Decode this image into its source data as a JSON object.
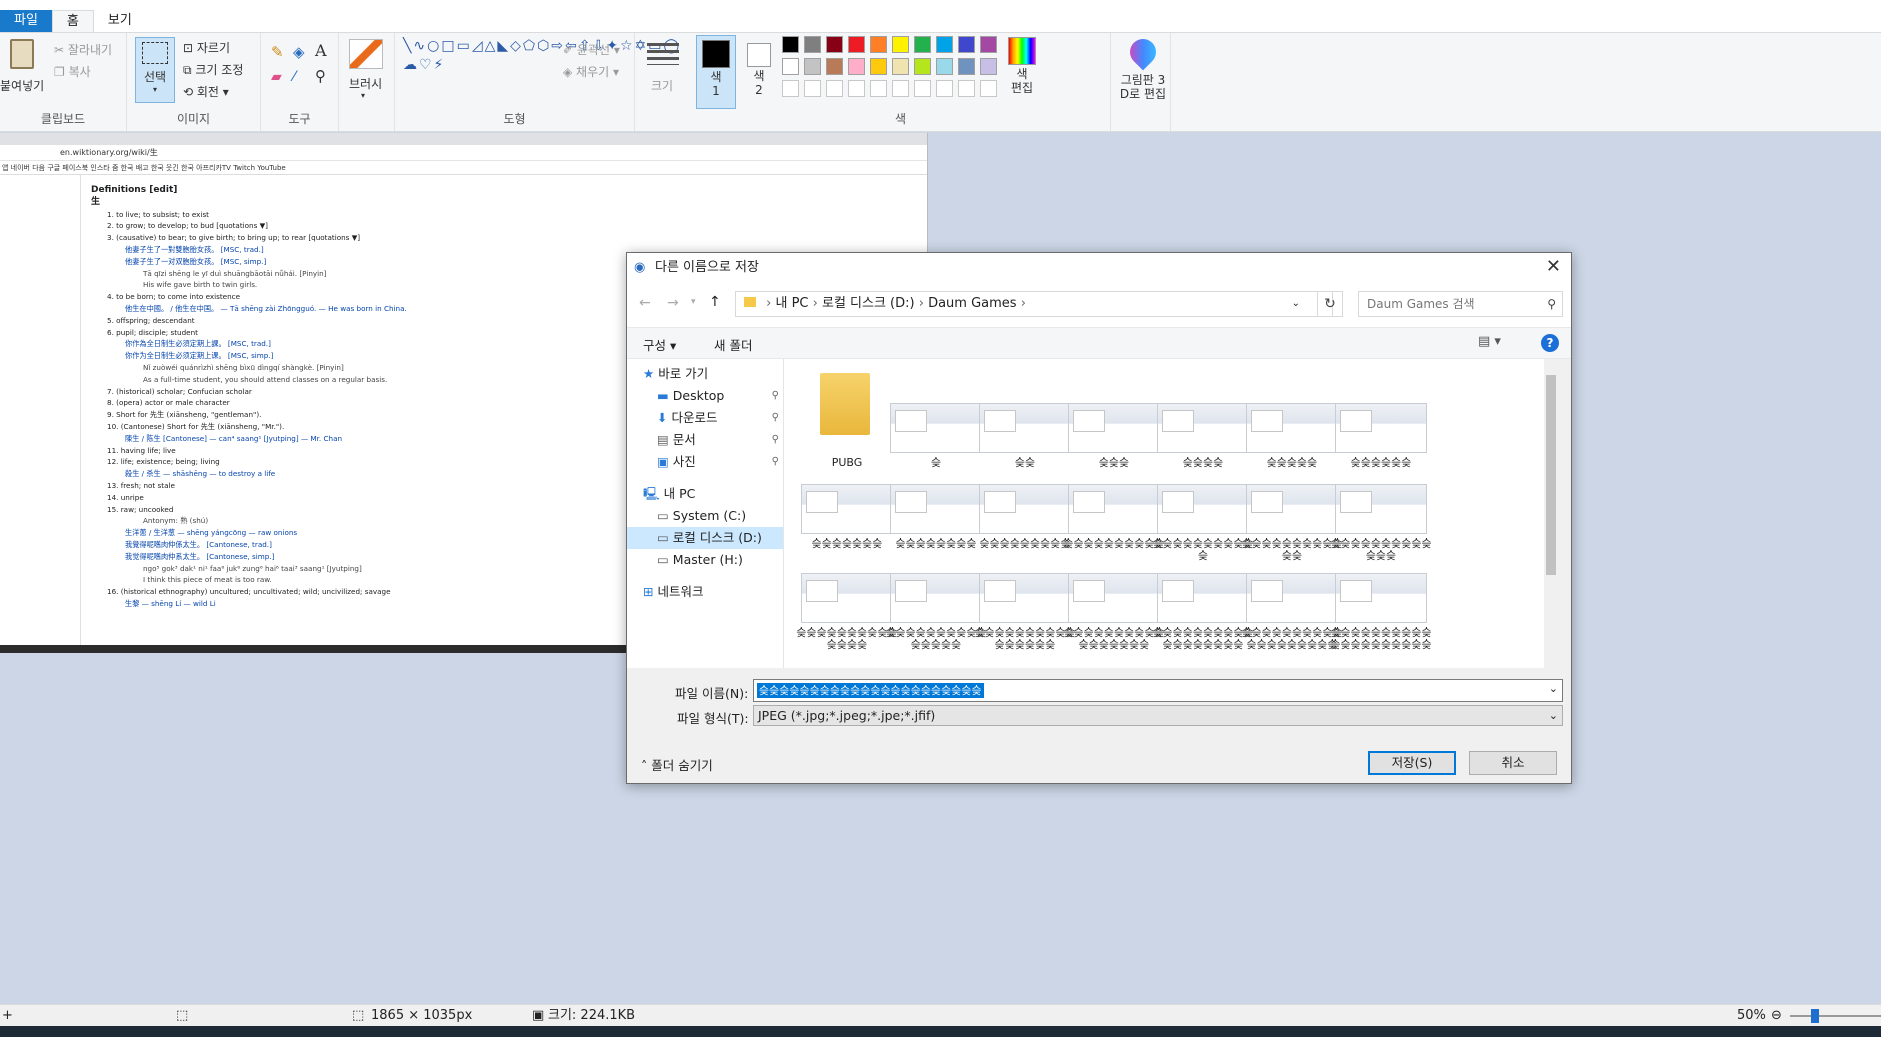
{
  "ribbon": {
    "tabs": [
      "파일",
      "홈",
      "보기"
    ],
    "clipboard": {
      "paste": "붙여넣기",
      "cut": "잘라내기",
      "copy": "복사",
      "label": "클립보드"
    },
    "image": {
      "select": "선택",
      "crop": "자르기",
      "resize": "크기 조정",
      "rotate": "회전",
      "label": "이미지"
    },
    "tools": {
      "label": "도구"
    },
    "brushes": {
      "label": "브러시"
    },
    "shapes": {
      "outline": "윤곽선",
      "fill": "채우기",
      "label": "도형"
    },
    "size": {
      "label": "크기"
    },
    "colors": {
      "color1": "색\n1",
      "color2": "색\n2",
      "edit": "색\n편집",
      "label": "색",
      "palette": [
        "#000000",
        "#7f7f7f",
        "#880015",
        "#ed1c24",
        "#ff7f27",
        "#fff200",
        "#22b14c",
        "#00a2e8",
        "#3f48cc",
        "#a349a4",
        "#ffffff",
        "#c3c3c3",
        "#b97a57",
        "#ffaec9",
        "#ffc90e",
        "#efe4b0",
        "#b5e61d",
        "#99d9ea",
        "#7092be",
        "#c8bfe7"
      ]
    },
    "paint3d": "그림판 3\nD로 편집"
  },
  "canvas_page": {
    "url": "en.wiktionary.org/wiki/生",
    "bookmarks": "앱   네이버   다음   구글   페이스북   인스타   줌 한국   배고 한국   웃긴 한국   아프리카TV   Twitch   YouTube",
    "heading": "Definitions  [edit]",
    "char": "生",
    "items": [
      "1. to live; to subsist; to exist",
      "2. to grow; to develop; to bud  [quotations ▼]",
      "3. (causative) to bear; to give birth; to bring up; to rear  [quotations ▼]",
      "他妻子生了一對雙胞胎女孩。 [MSC, trad.]",
      "他妻子生了一对双胞胎女孩。 [MSC, simp.]",
      "Tā qīzi shēng le yī duì shuāngbāotāi nǚhái. [Pinyin]",
      "His wife gave birth to twin girls.",
      "4. to be born; to come into existence",
      "他生在中國。 / 他生在中国。 — Tā shēng zài Zhōngguó. — He was born in China.",
      "5. offspring; descendant",
      "6. pupil; disciple; student",
      "你作為全日制生必須定期上課。 [MSC, trad.]",
      "你作为全日制生必须定期上课。 [MSC, simp.]",
      "Nǐ zuòwéi quánrìzhì shēng bìxū dìngqí shàngkè. [Pinyin]",
      "As a full-time student, you should attend classes on a regular basis.",
      "7. (historical) scholar; Confucian scholar",
      "8. (opera) actor or male character",
      "9. Short for 先生 (xiānsheng, \"gentleman\").",
      "10. (Cantonese) Short for 先生 (xiānsheng, \"Mr.\").",
      "陳生 / 陈生 [Cantonese] — can⁴ saang¹ [Jyutping] — Mr. Chan",
      "11. having life; live",
      "12. life; existence; being; living",
      "殺生 / 杀生 — shāshēng — to destroy a life",
      "13. fresh; not stale",
      "14. unripe",
      "15. raw; uncooked",
      "Antonym: 熟 (shú)",
      "生洋蔥 / 生洋葱 — shēng yángcōng — raw onions",
      "我覺得呢嚿肉仲係太生。 [Cantonese, trad.]",
      "我觉得呢嚿肉仲系太生。 [Cantonese, simp.]",
      "ngo⁵ gok³ dak¹ ni¹ faa⁶ juk⁶ zung⁶ hai⁶ taai³ saang¹ [Jyutping]",
      "I think this piece of meat is too raw.",
      "16. (historical ethnography) uncultured; uncultivated; wild; uncivilized; savage",
      "生黎 — shēng Lí — wild Li"
    ]
  },
  "dialog": {
    "title": "다른 이름으로 저장",
    "breadcrumb": [
      "내 PC",
      "로컬 디스크 (D:)",
      "Daum Games"
    ],
    "search_placeholder": "Daum Games 검색",
    "organize": "구성 ▾",
    "new_folder": "새 폴더",
    "nav": {
      "quick_access": "바로 가기",
      "desktop": "Desktop",
      "downloads": "다운로드",
      "documents": "문서",
      "pictures": "사진",
      "this_pc": "내 PC",
      "system_c": "System (C:)",
      "local_d": "로컬 디스크 (D:)",
      "master_h": "Master (H:)",
      "network": "네트워크"
    },
    "files": [
      "PUBG",
      "슺",
      "슺슺",
      "슺슺슺",
      "슺슺슺슺",
      "슺슺슺슺슺",
      "슺슺슺슺슺슺",
      "슺슺슺슺슺슺슺",
      "슺슺슺슺슺슺슺슺",
      "슺슺슺슺슺슺슺슺슺",
      "슺슺슺슺슺슺슺슺슺슺",
      "슺슺슺슺슺슺슺슺슺슺슺",
      "슺슺슺슺슺슺슺슺슺슺슺슺",
      "슺슺슺슺슺슺슺슺슺슺슺슺슺",
      "슺슺슺슺슺슺슺슺슺슺슺슺슺슺",
      "슺슺슺슺슺슺슺슺슺슺슺슺슺슺슺",
      "슺슺슺슺슺슺슺슺슺슺슺슺슺슺슺슺",
      "슺슺슺슺슺슺슺슺슺슺슺슺슺슺슺슺슺",
      "슺슺슺슺슺슺슺슺슺슺슺슺슺슺슺슺슺슺",
      "슺슺슺슺슺슺슺슺슺슺슺슺슺슺슺슺슺슺슺",
      "슺슺슺슺슺슺슺슺슺슺슺슺슺슺슺슺슺슺슺슺"
    ],
    "filename_label": "파일 이름(N):",
    "filename_value": "슺슺슺슺슺슺슺슺슺슺슺슺슺슺슺슺슺슺슺슺슺슺",
    "filetype_label": "파일 형식(T):",
    "filetype_value": "JPEG (*.jpg;*.jpeg;*.jpe;*.jfif)",
    "hide_folders": "폴더 숨기기",
    "save": "저장(S)",
    "cancel": "취소"
  },
  "status": {
    "dimensions": "1865 × 1035px",
    "size": "크기: 224.1KB",
    "zoom": "50%"
  }
}
